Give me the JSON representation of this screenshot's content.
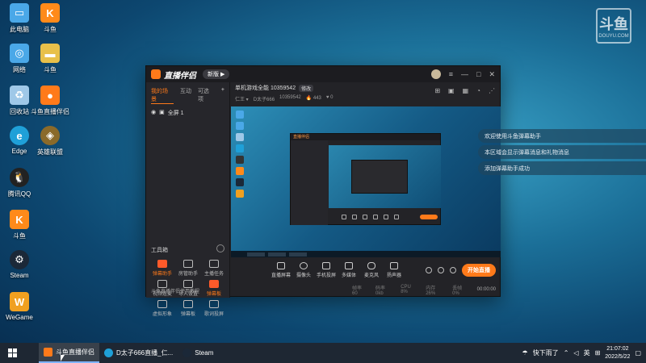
{
  "desktop": {
    "icons": [
      {
        "label": "此电脑",
        "icon": "computer-icon",
        "color": "#4aa8e8"
      },
      {
        "label": "斗鱼",
        "icon": "douyu-icon",
        "color": "#ff8a1a"
      },
      {
        "label": "网络",
        "icon": "network-icon",
        "color": "#4aa8e8"
      },
      {
        "label": "斗鱼",
        "icon": "folder-icon",
        "color": "#e8c04a"
      },
      {
        "label": "回收站",
        "icon": "recycle-bin-icon",
        "color": "#9fc8e8"
      },
      {
        "label": "斗鱼直播伴侣",
        "icon": "douyu-companion-icon",
        "color": "#ff7a1a"
      },
      {
        "label": "Edge",
        "icon": "edge-icon",
        "color": "#1fa0d8"
      },
      {
        "label": "英雄联盟",
        "icon": "lol-icon",
        "color": "#8a6a2a"
      },
      {
        "label": "腾讯QQ",
        "icon": "qq-icon",
        "color": "#222"
      },
      {
        "label": "斗鱼",
        "icon": "douyu-icon",
        "color": "#ff8a1a"
      },
      {
        "label": "Steam",
        "icon": "steam-icon",
        "color": "#1b2838"
      },
      {
        "label": "WeGame",
        "icon": "wegame-icon",
        "color": "#f0a020"
      }
    ],
    "watermark": {
      "big": "斗鱼",
      "small": "DOUYU.COM"
    }
  },
  "app": {
    "name": "直播伴侣",
    "version_badge": "新版 ▶",
    "tabs": [
      "我的场景",
      "互动",
      "可选项"
    ],
    "tab_add": "+",
    "scene_label": "全屏 1",
    "tools_heading": "工具箱",
    "tools": [
      {
        "label": "弹幕助手",
        "icon": "danmu-assistant-icon",
        "active": true
      },
      {
        "label": "房管助手",
        "icon": "room-manager-icon",
        "active": false
      },
      {
        "label": "主播任务",
        "icon": "anchor-task-icon",
        "active": false
      },
      {
        "label": "视频连麦",
        "icon": "video-link-icon",
        "active": false
      },
      {
        "label": "导入设置",
        "icon": "import-icon",
        "active": false
      },
      {
        "label": "弹幕板",
        "icon": "danmu-board-icon",
        "active": true
      },
      {
        "label": "虚拟形象",
        "icon": "avatar-virtual-icon",
        "active": false
      },
      {
        "label": "弹幕板",
        "icon": "danmu-board-icon",
        "active": false
      },
      {
        "label": "歌词投屏",
        "icon": "lyrics-icon",
        "active": false
      }
    ],
    "tip": "斗鱼直播伴侣使用教程",
    "stream": {
      "title": "单机游戏全能 10359542",
      "badge": "修改",
      "meta": [
        "仁王 ▾",
        "D太子666",
        "10359542",
        "🔥 443",
        "♥ 0"
      ]
    },
    "header_icons": [
      "gift-icon",
      "lock-icon",
      "grid-icon",
      "bell-icon",
      "share-icon"
    ],
    "controls": [
      {
        "label": "直播屏幕",
        "icon": "screen-icon"
      },
      {
        "label": "摄像头",
        "icon": "camera-icon"
      },
      {
        "label": "手机投屏",
        "icon": "phone-cast-icon"
      },
      {
        "label": "多媒体",
        "icon": "media-icon"
      },
      {
        "label": "麦克风",
        "icon": "mic-icon"
      },
      {
        "label": "扬声器",
        "icon": "speaker-icon"
      }
    ],
    "go_live": "开始直播",
    "status": [
      "帧率 60",
      "码率 0kb",
      "CPU 8%",
      "内存 26%",
      "丢帧 0%"
    ],
    "time": "00:00:00"
  },
  "notifications": [
    "欢迎使用斗鱼弹幕助手",
    "本区域会显示弹幕消息和礼物消息",
    "添加弹幕助手成功"
  ],
  "taskbar": {
    "apps": [
      {
        "label": "斗鱼直播伴侣",
        "icon": "douyu-companion-icon",
        "color": "#ff7a1a",
        "active": true
      },
      {
        "label": "D太子666直播_仁...",
        "icon": "edge-icon",
        "color": "#1fa0d8",
        "active": false
      },
      {
        "label": "Steam",
        "icon": "steam-icon",
        "color": "#1b2838",
        "active": false
      }
    ],
    "weather": "快下雨了",
    "lang": "英",
    "time": "21:07:02",
    "date": "2022/5/22"
  }
}
